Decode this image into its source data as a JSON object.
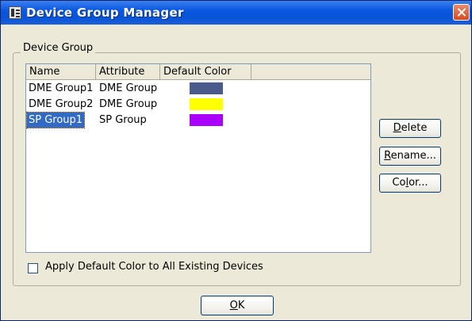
{
  "window": {
    "title": "Device Group Manager"
  },
  "device_group": {
    "label": "Device Group",
    "columns": [
      "Name",
      "Attribute",
      "Default Color"
    ],
    "rows": [
      {
        "name": "DME Group1",
        "attribute": "DME Group",
        "color": "#4a5a8a",
        "selected": false
      },
      {
        "name": "DME Group2",
        "attribute": "DME Group",
        "color": "#ffff00",
        "selected": false
      },
      {
        "name": "SP Group1",
        "attribute": "SP Group",
        "color": "#aa00ff",
        "selected": true
      }
    ]
  },
  "buttons": {
    "delete": {
      "accel": "D",
      "rest": "elete"
    },
    "rename": {
      "accel": "R",
      "rest": "ename..."
    },
    "color": {
      "pre": "Co",
      "accel": "l",
      "rest": "or..."
    },
    "ok": {
      "accel": "O",
      "rest": "K"
    }
  },
  "apply_default_color": {
    "label": "Apply Default Color to All Existing Devices",
    "checked": false
  },
  "colors": {
    "titlebar": "#0a58e0",
    "selection": "#316ac5",
    "dialog_bg": "#ece9d8"
  }
}
